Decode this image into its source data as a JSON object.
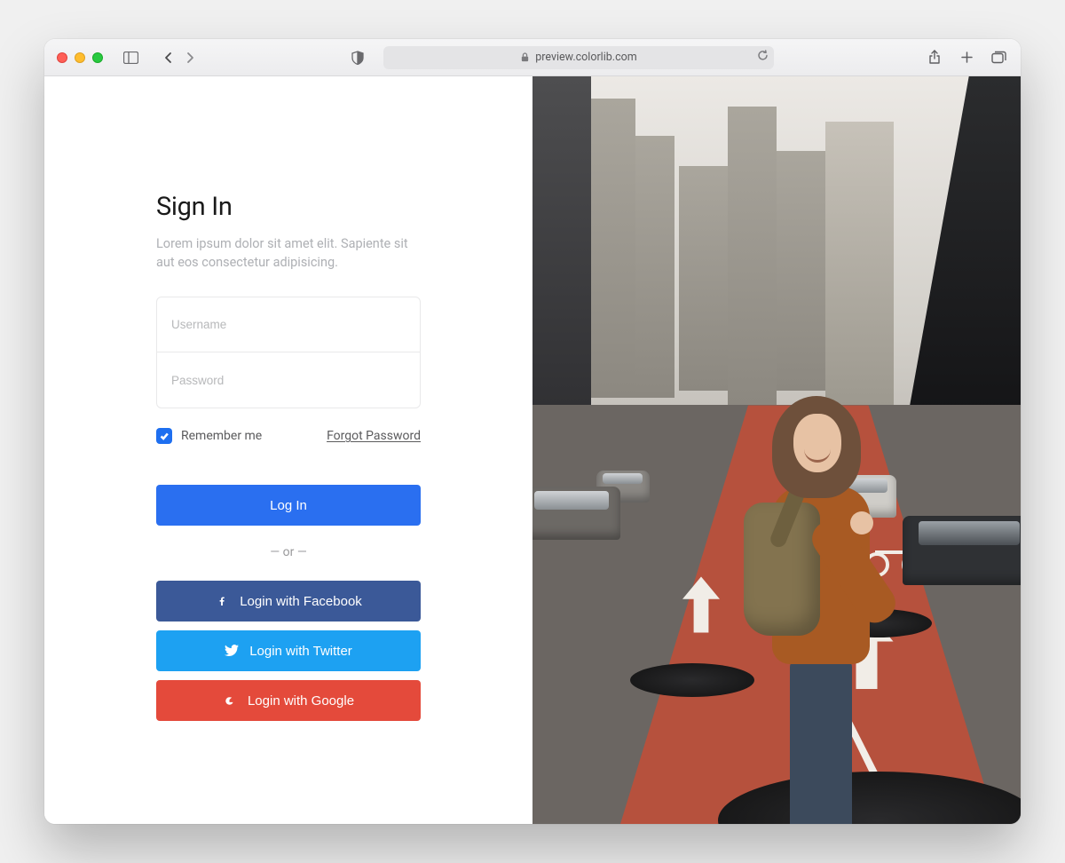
{
  "browser": {
    "url_display": "preview.colorlib.com"
  },
  "page": {
    "heading": "Sign In",
    "subtext": "Lorem ipsum dolor sit amet elit. Sapiente sit aut eos consectetur adipisicing.",
    "username_placeholder": "Username",
    "password_placeholder": "Password",
    "remember_label": "Remember me",
    "remember_checked": true,
    "forgot_label": "Forgot Password",
    "login_button": "Log In",
    "or_separator": "— or —",
    "facebook_button": "Login with Facebook",
    "twitter_button": "Login with Twitter",
    "google_button": "Login with Google"
  }
}
